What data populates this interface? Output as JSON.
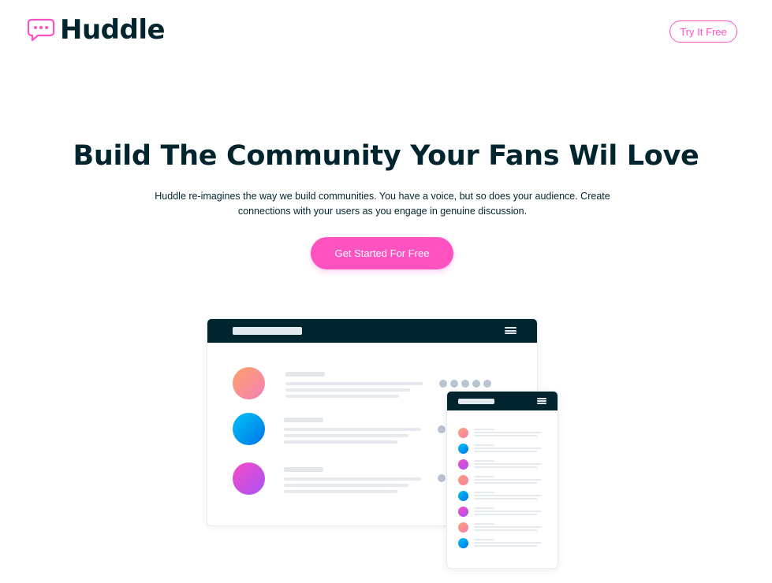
{
  "header": {
    "logo_text": "Huddle",
    "logo_icon": "chat-bubble-icon",
    "try_button_label": "Try It Free"
  },
  "hero": {
    "headline": "Build The Community Your Fans Wil Love",
    "subtext": "Huddle re-imagines the way we build communities. You have a voice, but so does your audience. Create connections with your users as you engage in genuine discussion.",
    "cta_label": "Get Started For Free"
  },
  "colors": {
    "primary_dark": "#00252e",
    "accent_pink": "#ff52c1",
    "placeholder_gray": "#e6eaee",
    "dot_gray": "#b8c4d1"
  },
  "illustration": {
    "desktop_rows": [
      {
        "avatar": "orange-gradient"
      },
      {
        "avatar": "blue-gradient"
      },
      {
        "avatar": "purple-gradient"
      }
    ],
    "mobile_rows": [
      {
        "avatar": "orange-gradient"
      },
      {
        "avatar": "blue-gradient"
      },
      {
        "avatar": "purple-gradient"
      },
      {
        "avatar": "orange-gradient"
      },
      {
        "avatar": "blue-gradient"
      },
      {
        "avatar": "purple-gradient"
      },
      {
        "avatar": "orange-gradient"
      },
      {
        "avatar": "blue-gradient"
      }
    ]
  }
}
